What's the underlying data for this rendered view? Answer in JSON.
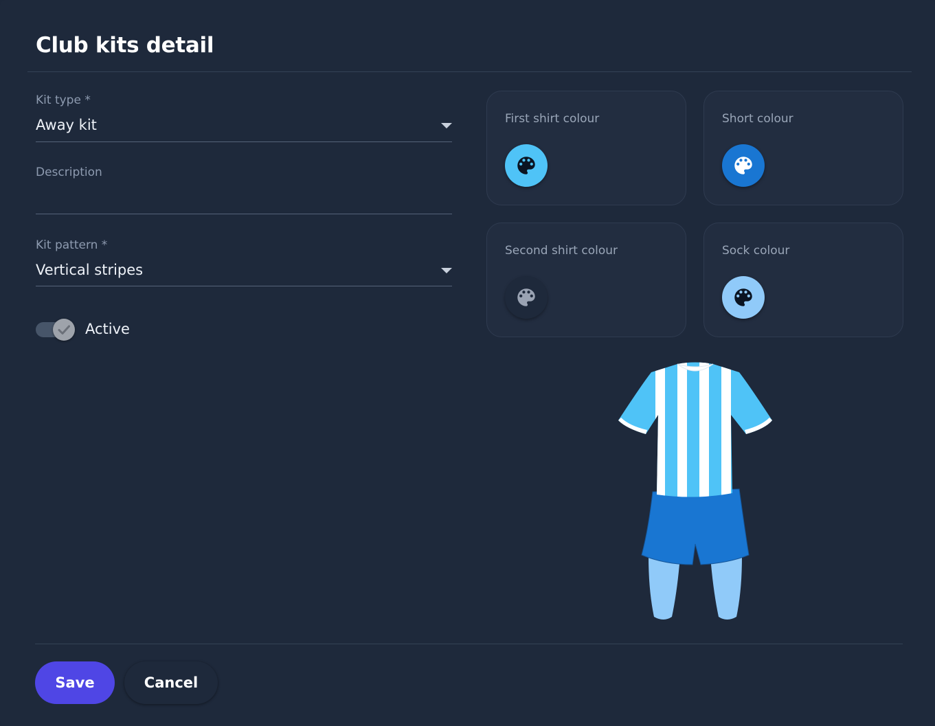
{
  "dialog": {
    "title": "Club kits detail"
  },
  "form": {
    "kit_type": {
      "label": "Kit type *",
      "value": "Away kit"
    },
    "description": {
      "label": "Description",
      "value": ""
    },
    "kit_pattern": {
      "label": "Kit pattern *",
      "value": "Vertical stripes"
    },
    "active": {
      "label": "Active",
      "checked": true
    }
  },
  "colour_cards": {
    "first_shirt": {
      "label": "First shirt colour",
      "color": "#4fc3f7",
      "icon": "palette-icon"
    },
    "short": {
      "label": "Short colour",
      "color": "#1976d2",
      "icon": "palette-icon"
    },
    "second_shirt": {
      "label": "Second shirt colour",
      "color": "#ffffff",
      "icon": "palette-icon"
    },
    "sock": {
      "label": "Sock colour",
      "color": "#90caf9",
      "icon": "palette-icon"
    }
  },
  "kit_preview": {
    "pattern": "vertical-stripes",
    "shirt_primary": "#4fc3f7",
    "shirt_secondary": "#ffffff",
    "shorts": "#1976d2",
    "socks": "#90caf9"
  },
  "actions": {
    "save_label": "Save",
    "cancel_label": "Cancel"
  },
  "colors": {
    "accent": "#4f46e5",
    "background": "#1e293b"
  }
}
